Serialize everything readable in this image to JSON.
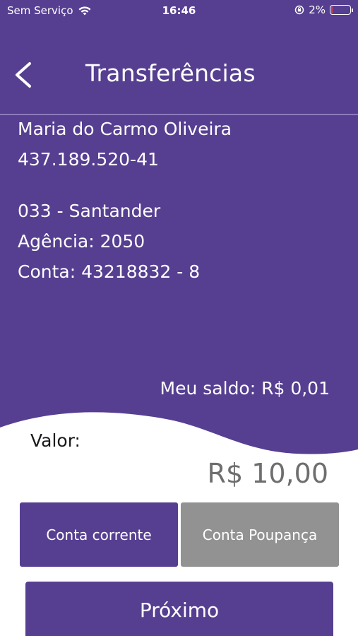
{
  "status_bar": {
    "carrier": "Sem Serviço",
    "time": "16:46",
    "battery": "2%"
  },
  "header": {
    "title": "Transferências"
  },
  "recipient": {
    "name": "Maria do Carmo Oliveira",
    "document": "437.189.520-41",
    "bank": "033 - Santander",
    "agency": "Agência: 2050",
    "account": "Conta: 43218832 - 8"
  },
  "balance": "Meu saldo: R$ 0,01",
  "amount": {
    "label": "Valor:",
    "value": "R$ 10,00"
  },
  "account_types": {
    "checking": "Conta corrente",
    "savings": "Conta Poupança"
  },
  "actions": {
    "next": "Próximo"
  },
  "colors": {
    "primary": "#563f91",
    "inactive": "#929292"
  }
}
